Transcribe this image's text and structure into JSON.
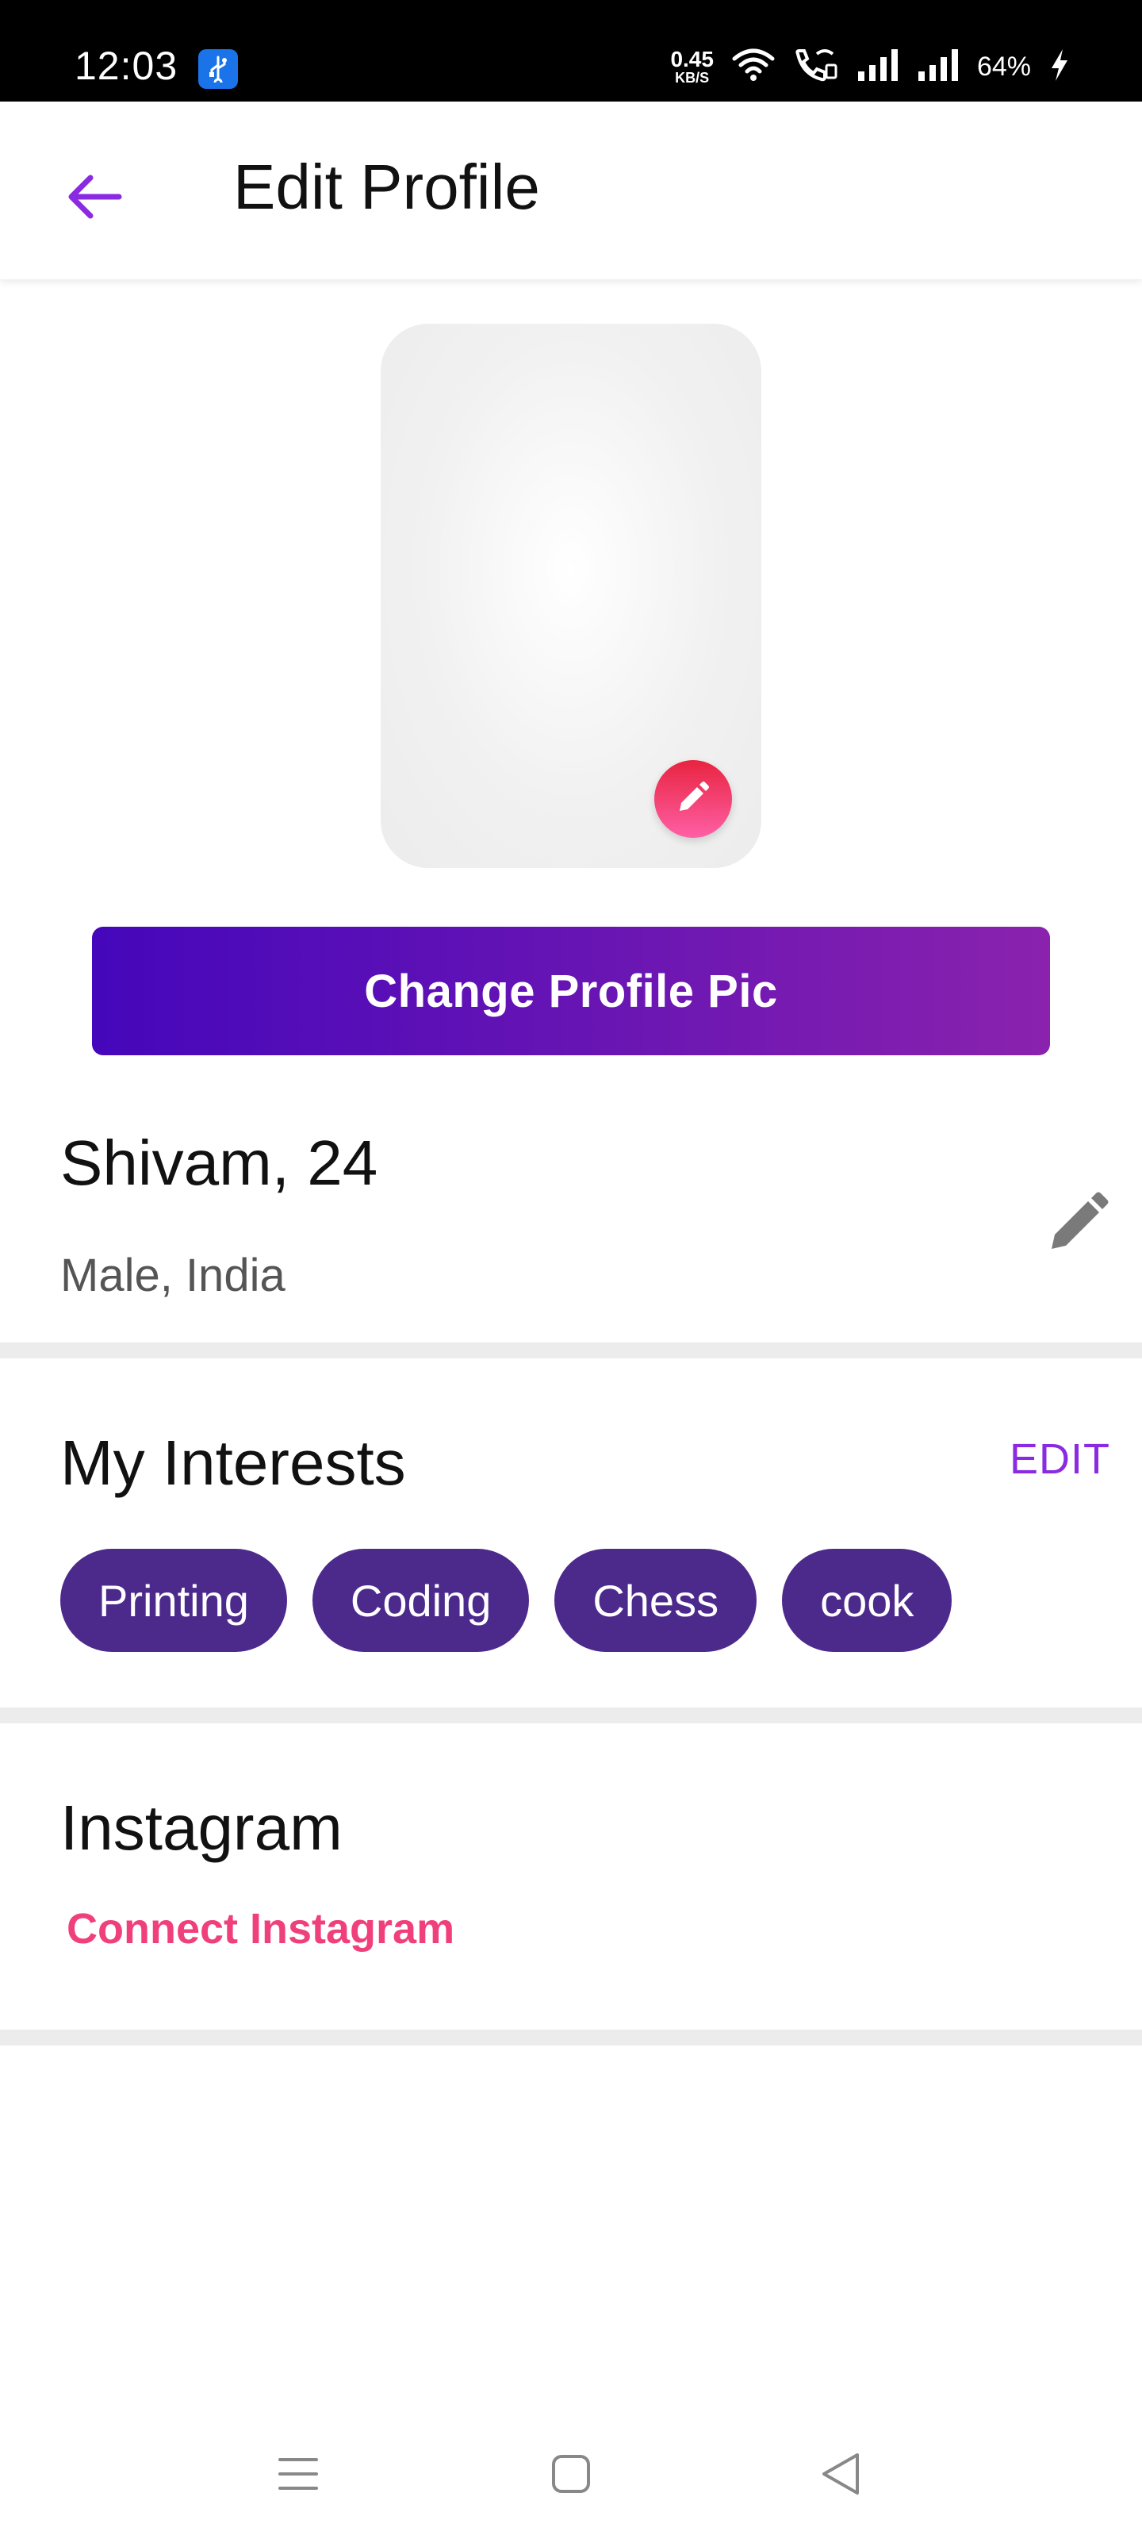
{
  "status_bar": {
    "time": "12:03",
    "net_speed_value": "0.45",
    "net_speed_unit": "KB/S",
    "battery": "64%",
    "icons": [
      "usb-icon",
      "wifi-icon",
      "wifi-call-icon",
      "signal-icon",
      "signal-icon",
      "charging-icon"
    ]
  },
  "header": {
    "title": "Edit Profile",
    "back_icon": "arrow-left-icon"
  },
  "photo": {
    "edit_icon": "pencil-icon"
  },
  "change_pic_label": "Change Profile Pic",
  "profile": {
    "name_age": "Shivam, 24",
    "location": "Male, India",
    "edit_icon": "pencil-icon"
  },
  "interests": {
    "title": "My Interests",
    "edit_label": "EDIT",
    "items": [
      "Printing",
      "Coding",
      "Chess",
      "cook"
    ]
  },
  "instagram": {
    "title": "Instagram",
    "connect_label": "Connect Instagram"
  },
  "nav": {
    "icons": [
      "menu-icon",
      "home-icon",
      "back-icon"
    ]
  },
  "colors": {
    "accent_purple": "#8a2be2",
    "chip_purple": "#4c2a8c",
    "button_gradient_start": "#4507bb",
    "button_gradient_end": "#8a22ae",
    "instagram_pink": "#f0407b",
    "photo_edit_red": "#e8243f"
  }
}
